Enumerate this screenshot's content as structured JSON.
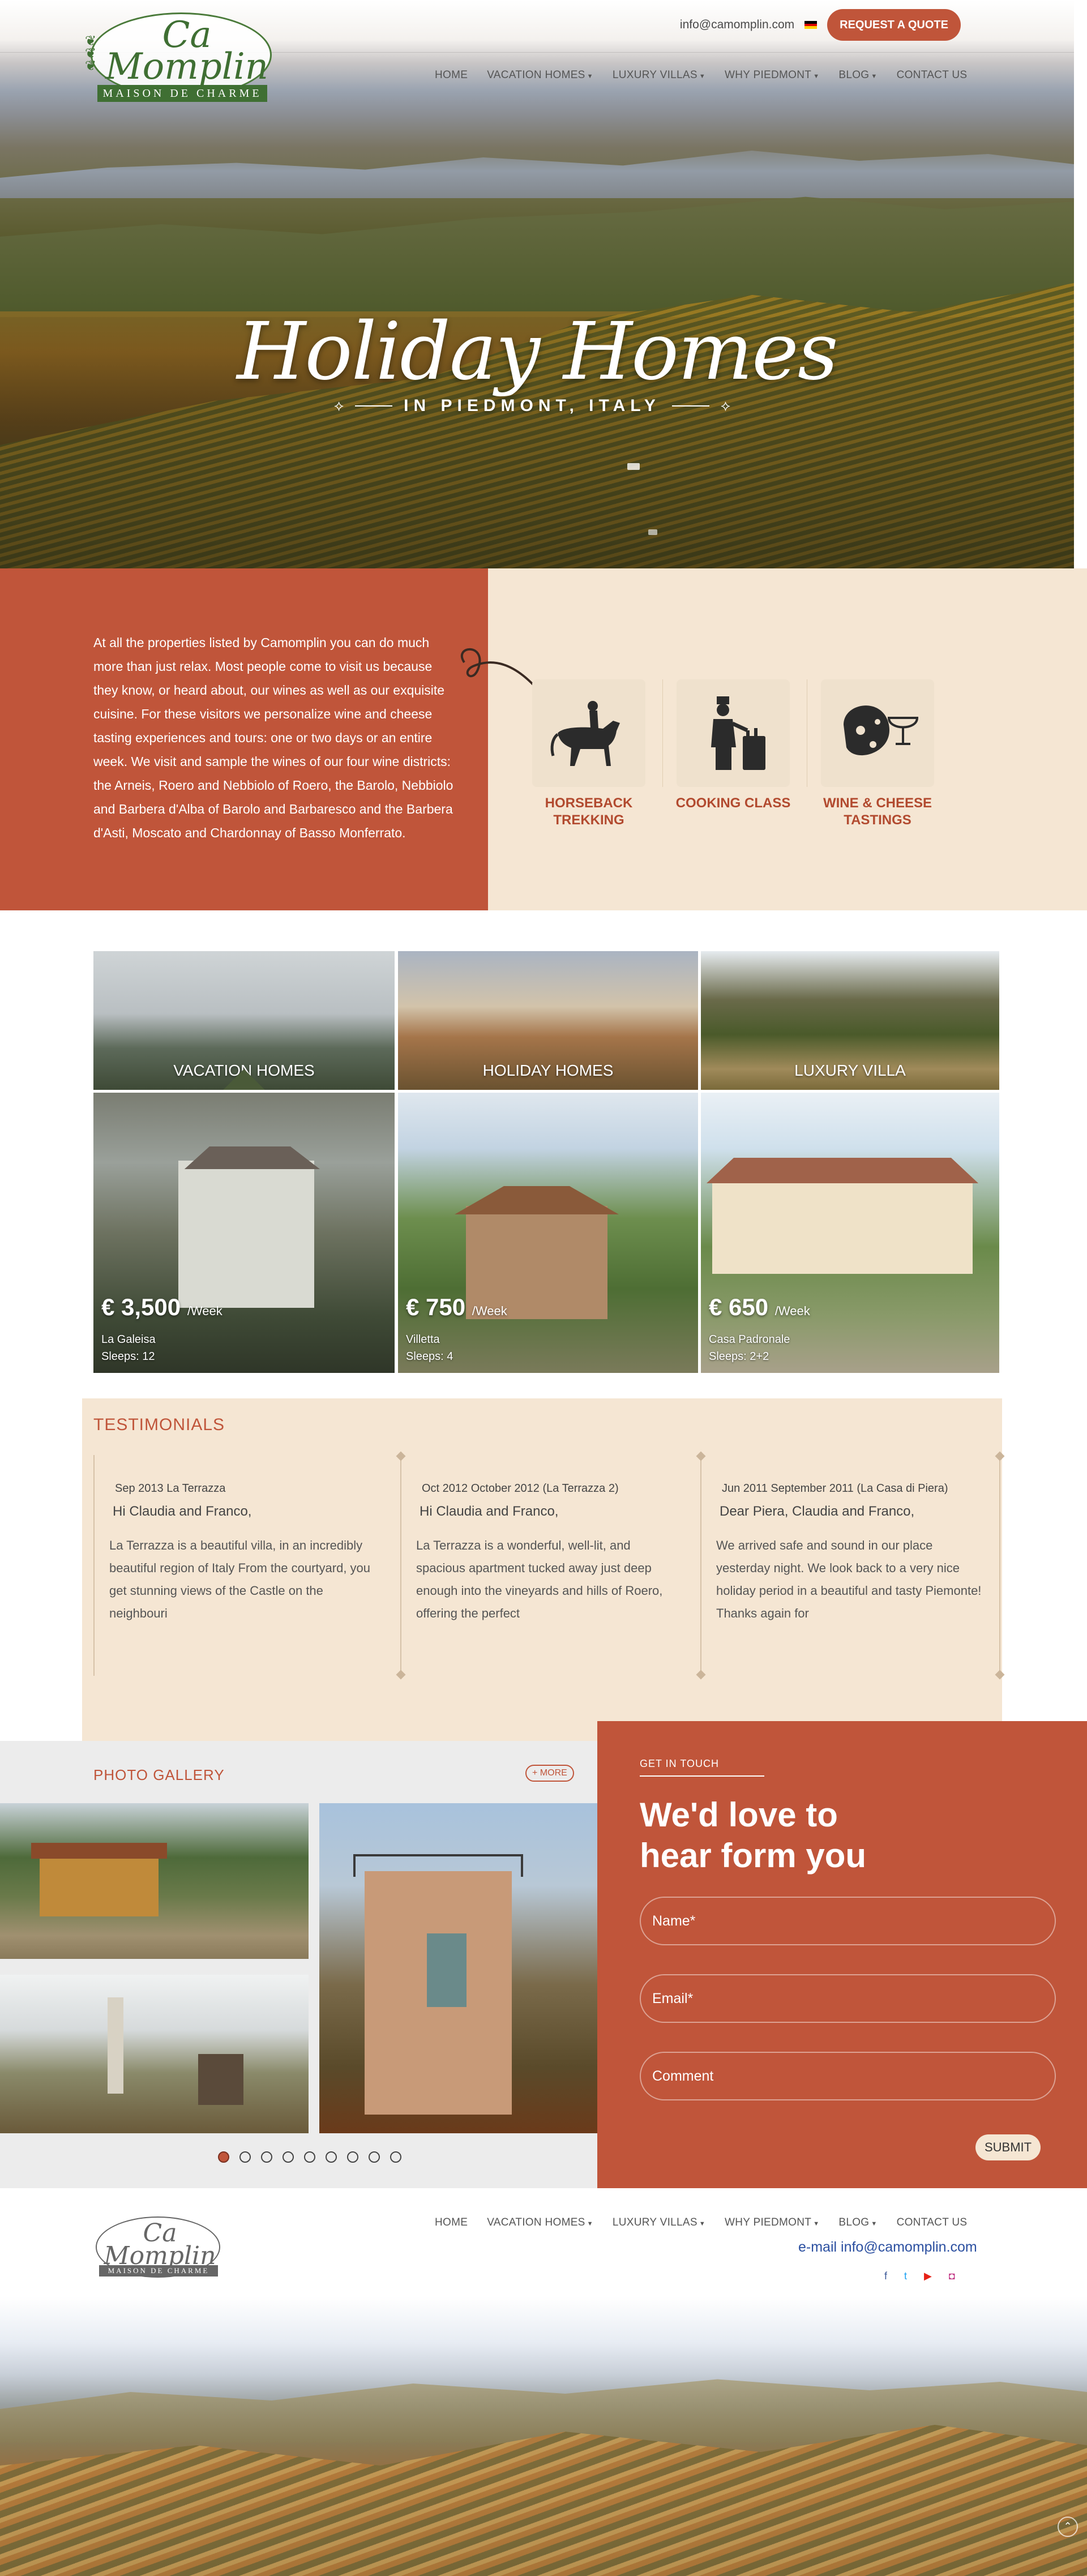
{
  "header": {
    "logo_name": "Ca Momplin",
    "logo_sub": "MAISON DE CHARME",
    "email": "info@camomplin.com",
    "quote_button": "REQUEST A QUOTE"
  },
  "nav": {
    "items": [
      {
        "label": "HOME",
        "dropdown": false
      },
      {
        "label": "VACATION HOMES",
        "dropdown": true
      },
      {
        "label": "LUXURY VILLAS",
        "dropdown": true
      },
      {
        "label": "WHY PIEDMONT",
        "dropdown": true
      },
      {
        "label": "BLOG",
        "dropdown": true
      },
      {
        "label": "CONTACT US",
        "dropdown": false
      }
    ]
  },
  "hero": {
    "title": "Holiday Homes",
    "subtitle": "IN PIEDMONT, ITALY"
  },
  "intro": {
    "text": "At all the properties listed by Camomplin you can do much more than just relax. Most people come to visit us because they know, or heard about, our wines as well as our exquisite cuisine. For these visitors we personalize wine and cheese tasting experiences and tours: one or two days or an entire week. We visit and sample the wines of our four wine districts: the Arneis, Roero and Nebbiolo of Roero, the Barolo, Nebbiolo and Barbera d'Alba of Barolo and Barbaresco and the Barbera d'Asti, Moscato and Chardonnay of Basso Monferrato.",
    "activities": [
      {
        "line1": "HORSEBACK",
        "line2": "TREKKING",
        "icon": "horse-rider-icon"
      },
      {
        "line1": "COOKING CLASS",
        "line2": "",
        "icon": "chef-icon"
      },
      {
        "line1": "WINE & CHEESE",
        "line2": "TASTINGS",
        "icon": "wine-cheese-icon"
      }
    ]
  },
  "tabs": [
    {
      "label": "VACATION HOMES",
      "active": true
    },
    {
      "label": "HOLIDAY HOMES",
      "active": false
    },
    {
      "label": "LUXURY VILLA",
      "active": false
    }
  ],
  "properties": [
    {
      "price": "€ 3,500",
      "unit": "/Week",
      "name": "La Galeisa",
      "sleeps": "Sleeps: 12"
    },
    {
      "price": "€ 750",
      "unit": "/Week",
      "name": "Villetta",
      "sleeps": "Sleeps: 4"
    },
    {
      "price": "€ 650",
      "unit": "/Week",
      "name": "Casa Padronale",
      "sleeps": "Sleeps: 2+2"
    }
  ],
  "testimonials": {
    "title": "TESTIMONIALS",
    "items": [
      {
        "date": "Sep 2013 La Terrazza",
        "greeting": "Hi Claudia and Franco,",
        "body": "La Terrazza is a beautiful villa, in an incredibly beautiful region of Italy From the courtyard, you get stunning views of the Castle on the neighbouri"
      },
      {
        "date": "Oct 2012 October 2012 (La Terrazza 2)",
        "greeting": "Hi Claudia and Franco,",
        "body": "La Terrazza is a wonderful, well-lit, and spacious apartment tucked away just deep enough into the vineyards and hills of Roero, offering the perfect"
      },
      {
        "date": "Jun 2011 September 2011 (La Casa di Piera)",
        "greeting": "Dear Piera, Claudia and Franco,",
        "body": "We arrived safe and sound in our place yesterday night. We look back to a very nice holiday period in a beautiful and tasty Piemonte! Thanks again for"
      }
    ]
  },
  "gallery": {
    "title": "PHOTO GALLERY",
    "more": "+ MORE",
    "dots": 9,
    "active_dot": 0
  },
  "contact": {
    "kicker": "GET IN TOUCH",
    "heading_line1": "We'd love to",
    "heading_line2": "hear form you",
    "name_placeholder": "Name*",
    "email_placeholder": "Email*",
    "comment_placeholder": "Comment",
    "submit": "SUBMIT"
  },
  "footer": {
    "email": "e-mail info@camomplin.com",
    "social": [
      {
        "icon": "facebook-icon",
        "glyph": "f",
        "color": "#3b5998"
      },
      {
        "icon": "twitter-icon",
        "glyph": "t",
        "color": "#1da1f2"
      },
      {
        "icon": "youtube-icon",
        "glyph": "▶",
        "color": "#e62117"
      },
      {
        "icon": "instagram-icon",
        "glyph": "◘",
        "color": "#c13584"
      }
    ]
  },
  "colors": {
    "accent": "#c0553a",
    "cream": "#f5e6d3",
    "logo_green": "#3f6f33"
  }
}
